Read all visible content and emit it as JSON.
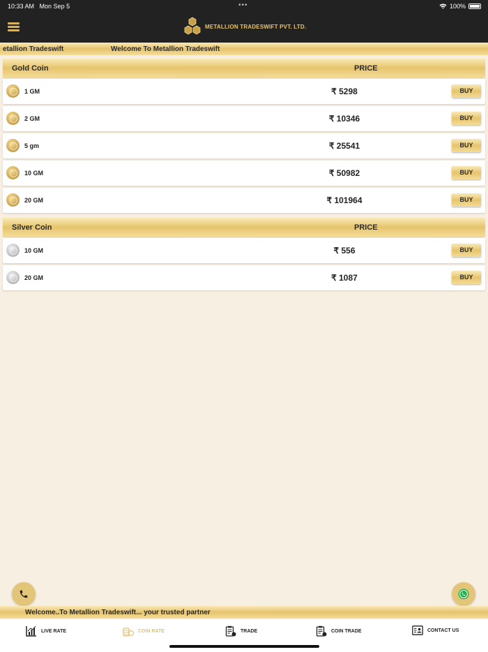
{
  "status": {
    "time": "10:33 AM",
    "date": "Mon Sep 5",
    "battery": "100%"
  },
  "header": {
    "logo_text": "METALLION TRADESWIFT PVT. LTD."
  },
  "ticker": {
    "part1": "etallion Tradeswift",
    "part2": "Welcome To Metallion Tradeswift"
  },
  "gold": {
    "title": "Gold Coin",
    "price_header": "PRICE",
    "rows": [
      {
        "weight": "1 GM",
        "price": "₹ 5298",
        "buy": "BUY"
      },
      {
        "weight": "2 GM",
        "price": "₹ 10346",
        "buy": "BUY"
      },
      {
        "weight": "5 gm",
        "price": "₹ 25541",
        "buy": "BUY"
      },
      {
        "weight": "10 GM",
        "price": "₹ 50982",
        "buy": "BUY"
      },
      {
        "weight": "20 GM",
        "price": "₹ 101964",
        "buy": "BUY"
      }
    ]
  },
  "silver": {
    "title": "Silver Coin",
    "price_header": "PRICE",
    "rows": [
      {
        "weight": "10 GM",
        "price": "₹ 556",
        "buy": "BUY"
      },
      {
        "weight": "20 GM",
        "price": "₹ 1087",
        "buy": "BUY"
      }
    ]
  },
  "bottom_ticker": "Welcome..To Metallion Tradeswift... your trusted partner",
  "tabs": [
    {
      "label": "LIVE RATE",
      "icon": "bar-chart-icon"
    },
    {
      "label": "COIN RATE",
      "icon": "coins-icon",
      "active": true
    },
    {
      "label": "TRADE",
      "icon": "clipboard-icon"
    },
    {
      "label": "COIN TRADE",
      "icon": "clipboard-icon"
    },
    {
      "label": "CONTACT US",
      "icon": "contact-card-icon"
    }
  ],
  "colors": {
    "accent_gold": "#e6c46d",
    "header_bg": "#222222",
    "page_bg": "#f7efe2",
    "active_tab": "#e0c27a"
  }
}
